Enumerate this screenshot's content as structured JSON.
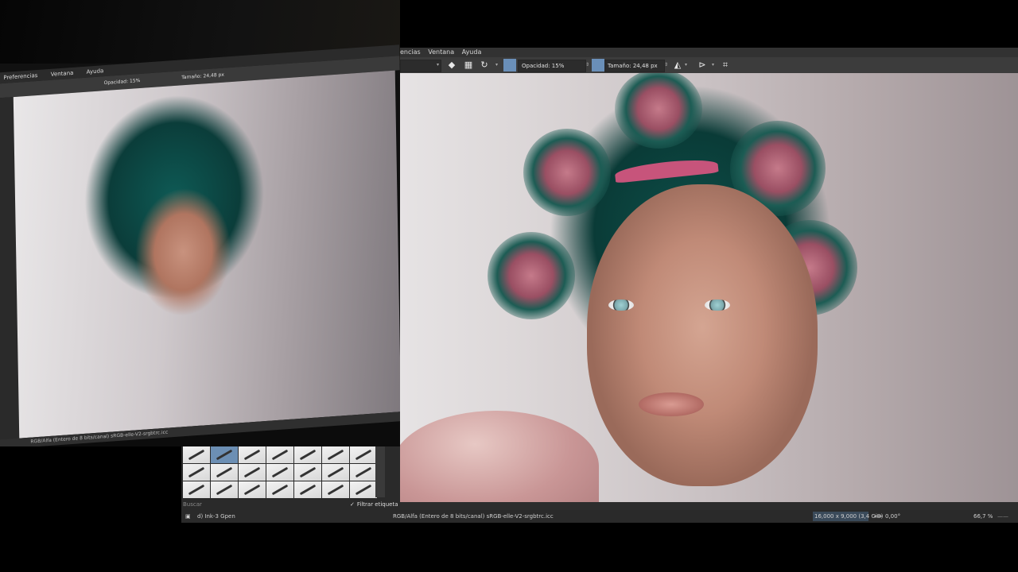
{
  "left_photo": {
    "menubar": [
      "Preferencias",
      "Ventana",
      "Ayuda"
    ],
    "toolbar": {
      "opacity_label": "Opacidad: 15%",
      "size_label": "Tamaño: 24,48 px"
    },
    "status_text": "RGB/Alfa (Entero de 8 bits/canal)  sRGB-elle-V2-srgbtrc.icc"
  },
  "brush_panel": {
    "search_placeholder": "Buscar",
    "filter_label": "Filtrar etiqueta"
  },
  "app": {
    "menubar": [
      "encias",
      "Ventana",
      "Ayuda"
    ],
    "toolbar": {
      "opacity_label": "Opacidad: 15%",
      "size_label": "Tamaño: 24,48 px",
      "accent_color": "#6a8fb8"
    },
    "statusbar": {
      "brush_name": "d) Ink-3 Gpen",
      "color_info": "RGB/Alfa (Entero de 8 bits/canal)  sRGB-elle-V2-srgbtrc.icc",
      "image_size": "16,000 x 9,000 (3,4 GiB)",
      "rotation": "0,00°",
      "zoom": "66,7 %"
    }
  },
  "icons": [
    "eraser-icon",
    "alpha-lock-icon",
    "reset-icon",
    "mirror-horizontal-icon",
    "mirror-vertical-icon",
    "wrap-icon",
    "canvas-size-icon",
    "rotation-icon"
  ]
}
